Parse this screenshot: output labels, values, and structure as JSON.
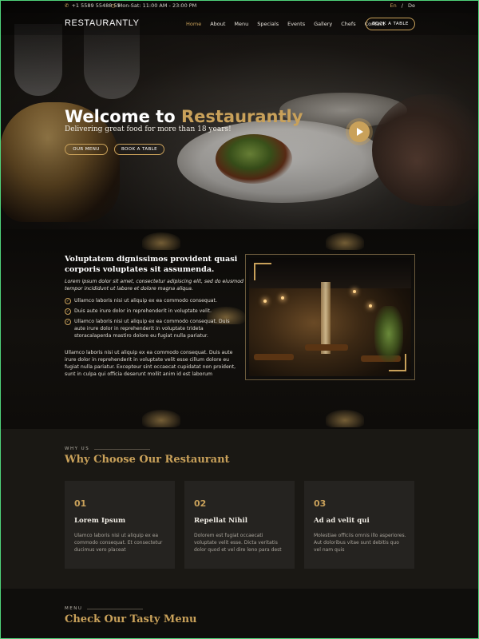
{
  "topbar": {
    "phone": "+1 5589 55488 55",
    "hours": "Mon-Sat: 11:00 AM - 23:00 PM",
    "lang_en": "En",
    "lang_sep": "/",
    "lang_de": "De"
  },
  "nav": {
    "logo": "RESTAURANTLY",
    "items": [
      "Home",
      "About",
      "Menu",
      "Specials",
      "Events",
      "Gallery",
      "Chefs",
      "Contact"
    ],
    "active": "Home",
    "book_button": "BOOK A TABLE"
  },
  "hero": {
    "title_prefix": "Welcome to ",
    "title_accent": "Restaurantly",
    "subtitle": "Delivering great food for more than 18 years!",
    "btn_menu": "OUR MENU",
    "btn_book": "BOOK A TABLE"
  },
  "about": {
    "title": "Voluptatem dignissimos provident quasi corporis voluptates sit assumenda.",
    "lead": "Lorem ipsum dolor sit amet, consectetur adipiscing elit, sed do eiusmod tempor incididunt ut labore et dolore magna aliqua.",
    "checks": [
      "Ullamco laboris nisi ut aliquip ex ea commodo consequat.",
      "Duis aute irure dolor in reprehenderit in voluptate velit.",
      "Ullamco laboris nisi ut aliquip ex ea commodo consequat. Duis aute irure dolor in reprehenderit in voluptate trideta storacalaperda mastiro dolore eu fugiat nulla pariatur."
    ],
    "paragraph": "Ullamco laboris nisi ut aliquip ex ea commodo consequat. Duis aute irure dolor in reprehenderit in voluptate velit esse cillum dolore eu fugiat nulla pariatur. Excepteur sint occaecat cupidatat non proident, sunt in culpa qui officia deserunt mollit anim id est laborum"
  },
  "why": {
    "kicker": "WHY US",
    "title": "Why Choose Our Restaurant",
    "cards": [
      {
        "num": "01",
        "title": "Lorem Ipsum",
        "text": "Ulamco laboris nisi ut aliquip ex ea commodo consequat. Et consectetur ducimus vero placeat"
      },
      {
        "num": "02",
        "title": "Repellat Nihil",
        "text": "Dolorem est fugiat occaecati voluptate velit esse. Dicta veritatis dolor quod et vel dire leno para dest"
      },
      {
        "num": "03",
        "title": "Ad ad velit qui",
        "text": "Molestiae officiis omnis illo asperiores. Aut doloribus vitae sunt debitis quo vel nam quis"
      }
    ]
  },
  "menu_section": {
    "kicker": "MENU",
    "title": "Check Our Tasty Menu"
  },
  "colors": {
    "accent": "#c9a15a",
    "background": "#0c0b09",
    "card": "#252320"
  }
}
